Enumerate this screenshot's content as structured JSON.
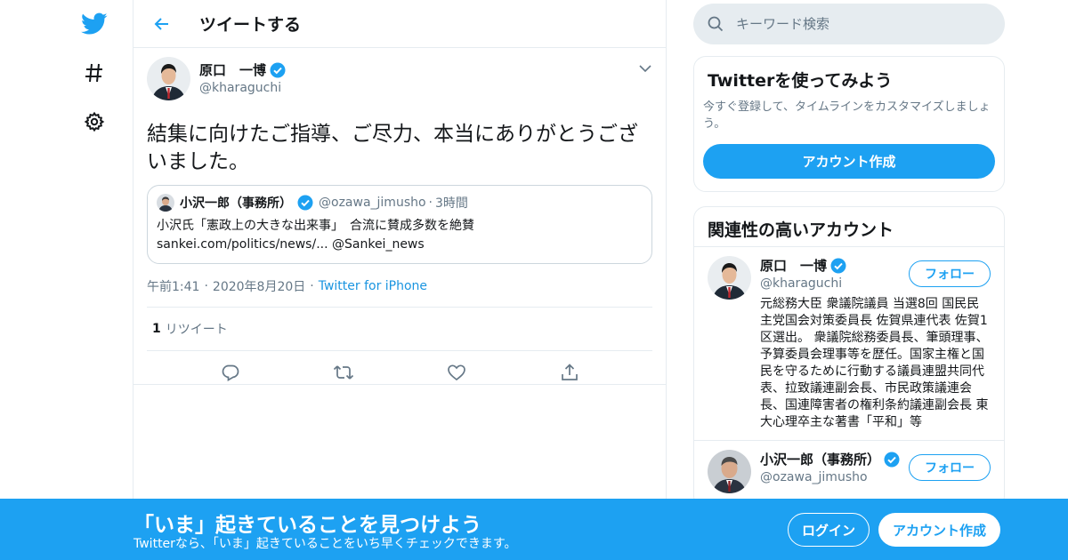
{
  "colors": {
    "accent": "#1da1f2",
    "text": "#14171a",
    "muted": "#657786",
    "border": "#e6ecf0",
    "link": "#1b95e0"
  },
  "rail": {
    "icons": [
      "twitter-logo-icon",
      "hashtag-icon",
      "gear-icon"
    ]
  },
  "header": {
    "title": "ツイートする",
    "back_icon": "back-arrow-icon"
  },
  "tweet": {
    "author": {
      "name": "原口　一博",
      "handle": "@kharaguchi",
      "verified": true
    },
    "text": "結集に向けたご指導、ご尽力、本当にありがとうございました。",
    "quote": {
      "author_name": "小沢一郎（事務所）",
      "handle": "@ozawa_jimusho",
      "separator": "·",
      "time": "3時間",
      "line1": "小沢氏「憲政上の大きな出来事」　合流に賛成多数を絶賛",
      "line2": "sankei.com/politics/news/... @Sankei_news"
    },
    "meta": {
      "time": "午前1:41",
      "dot": "·",
      "date": "2020年8月20日",
      "source": "Twitter for iPhone"
    },
    "stats": {
      "retweet_count": "1",
      "retweet_label": "リツイート"
    },
    "actions": [
      "reply-icon",
      "retweet-icon",
      "like-icon",
      "share-icon"
    ]
  },
  "sidebar": {
    "search": {
      "placeholder": "キーワード検索"
    },
    "signup_card": {
      "title": "Twitterを使ってみよう",
      "desc": "今すぐ登録して、タイムラインをカスタマイズしましょう。",
      "button": "アカウント作成"
    },
    "related": {
      "title": "関連性の高いアカウント",
      "accounts": [
        {
          "name": "原口　一博",
          "handle": "@kharaguchi",
          "follow": "フォロー",
          "bio": "元総務大臣 衆議院議員 当選8回 国民民主党国会対策委員長 佐賀県連代表 佐賀1区選出。 衆議院総務委員長、筆頭理事、予算委員会理事等を歴任。国家主権と国民を守るために行動する議員連盟共同代表、拉致議連副会長、市民政策議連会長、国連障害者の権利条約議連副会長 東大心理卒主な著書「平和」等"
        },
        {
          "name": "小沢一郎（事務所）",
          "handle": "@ozawa_jimusho",
          "follow": "フォロー"
        }
      ]
    }
  },
  "banner": {
    "title": "「いま」起きていることを見つけよう",
    "subtitle": "Twitterなら、「いま」起きていることをいち早くチェックできます。",
    "login": "ログイン",
    "signup": "アカウント作成"
  }
}
